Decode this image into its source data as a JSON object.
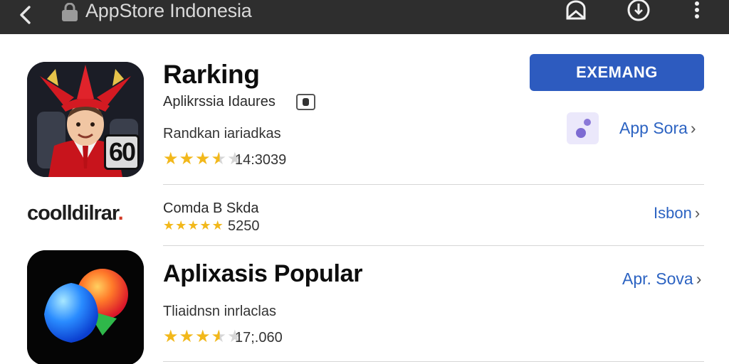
{
  "browser": {
    "url": "AppStore Indonesia",
    "icons": [
      "back-arrow-icon",
      "lock-icon",
      "bookmark-icon",
      "download-icon",
      "more-vert-icon"
    ]
  },
  "featured": {
    "title": "Rarking",
    "subtitle": "Aplikrssia Idaures",
    "category": "Randkan  iariadkas",
    "rating": 3.5,
    "rating_count": "14:3039",
    "icon_badge": "60",
    "button_label": "EXEMANG",
    "store_link": "App Sora"
  },
  "listing": {
    "logo_text": "coolldilrar",
    "logo_mark": ".",
    "name": "Comda B Skda",
    "rating": 5,
    "rating_count": "5250",
    "link": "Isbon"
  },
  "popular": {
    "title": "Aplixasis Popular",
    "category": "Tliaidnsn  inrlaclas",
    "rating": 3.5,
    "rating_count": "17;.060",
    "store_link": "Apr. Sova"
  },
  "colors": {
    "topbar": "#2e2e2e",
    "button": "#2d5bbf",
    "link": "#2c63c2",
    "star": "#f2b81b",
    "logo_accent": "#d23a26"
  }
}
